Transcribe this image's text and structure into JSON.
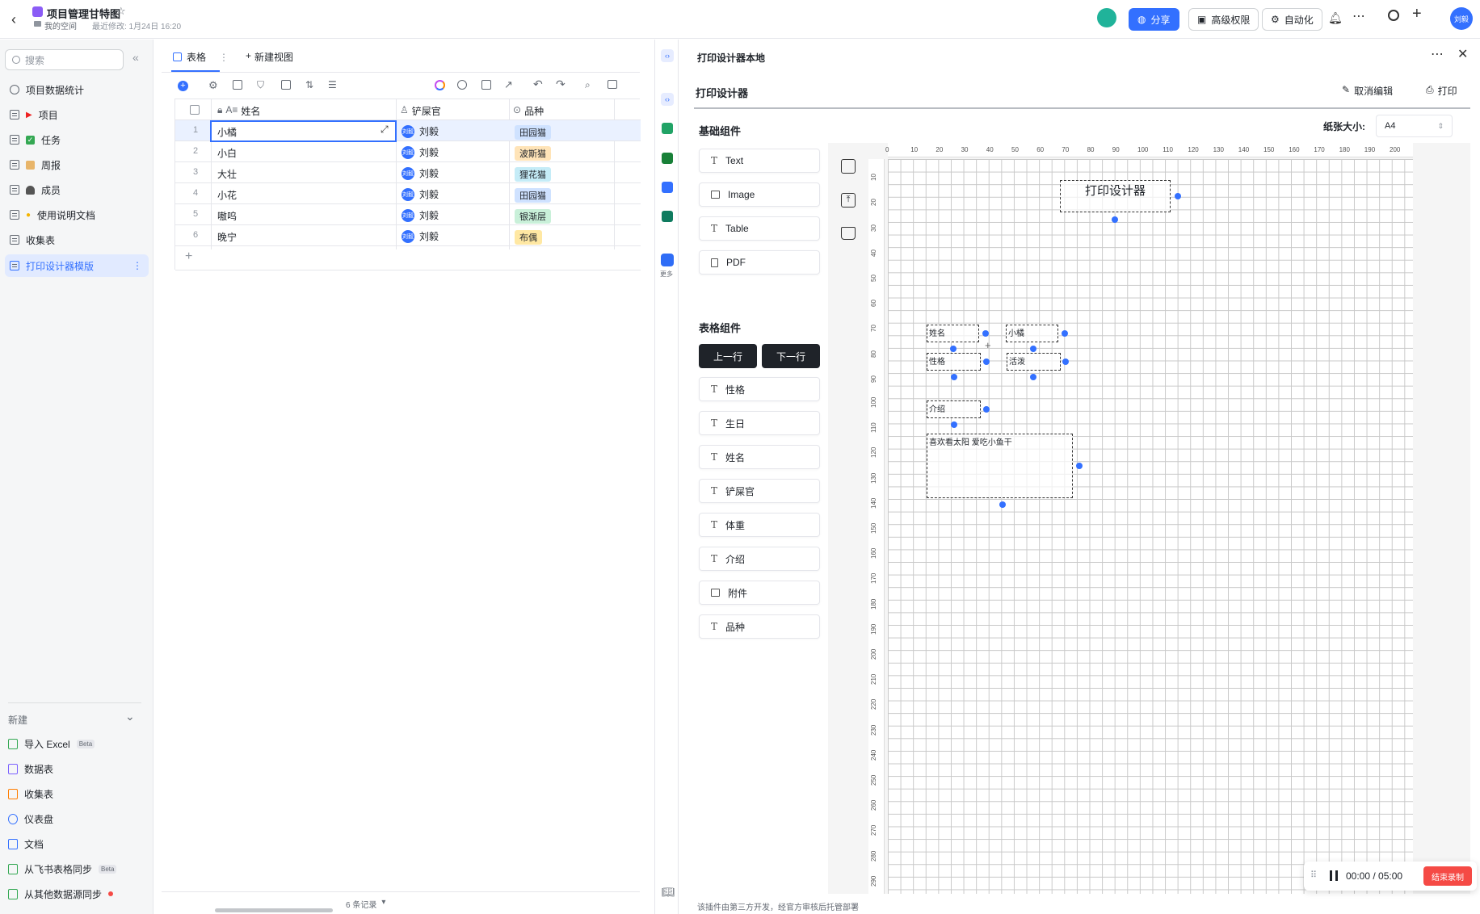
{
  "header": {
    "doc_title": "项目管理甘特图",
    "space_label": "我的空间",
    "last_modified": "最近修改: 1月24日 16:20",
    "share_label": "分享",
    "permission_label": "高级权限",
    "automation_label": "自动化",
    "user_initials": "刘毅"
  },
  "sidebar": {
    "search_placeholder": "搜索",
    "items": [
      {
        "label": "项目数据统计"
      },
      {
        "label": "项目"
      },
      {
        "label": "任务"
      },
      {
        "label": "周报"
      },
      {
        "label": "成员"
      },
      {
        "label": "使用说明文档"
      },
      {
        "label": "收集表"
      },
      {
        "label": "打印设计器模版"
      }
    ],
    "new_section": "新建",
    "new_items": [
      {
        "label": "导入 Excel",
        "badge": "Beta",
        "color": "#34a853"
      },
      {
        "label": "数据表",
        "color": "#7b61ff"
      },
      {
        "label": "收集表",
        "color": "#ff7d00"
      },
      {
        "label": "仪表盘",
        "color": "#3370ff"
      },
      {
        "label": "文档",
        "color": "#3370ff"
      },
      {
        "label": "从飞书表格同步",
        "badge": "Beta",
        "color": "#34a853"
      },
      {
        "label": "从其他数据源同步",
        "color": "#34a853"
      }
    ]
  },
  "table": {
    "view_tab": "表格",
    "new_view": "新建视图",
    "columns": [
      "姓名",
      "铲屎官",
      "品种"
    ],
    "rows": [
      {
        "n": "1",
        "name": "小橘",
        "owner": "刘毅",
        "breed": "田园猫",
        "color": "#cfe2ff"
      },
      {
        "n": "2",
        "name": "小白",
        "owner": "刘毅",
        "breed": "波斯猫",
        "color": "#ffe4b8"
      },
      {
        "n": "3",
        "name": "大壮",
        "owner": "刘毅",
        "breed": "狸花猫",
        "color": "#c5ecf7"
      },
      {
        "n": "4",
        "name": "小花",
        "owner": "刘毅",
        "breed": "田园猫",
        "color": "#cfe2ff"
      },
      {
        "n": "5",
        "name": "嗷呜",
        "owner": "刘毅",
        "breed": "银渐层",
        "color": "#c9f0d9"
      },
      {
        "n": "6",
        "name": "晚宁",
        "owner": "刘毅",
        "breed": "布偶",
        "color": "#ffe8a3"
      }
    ],
    "records": "6 条记录"
  },
  "plugin_more": "更多",
  "panel": {
    "title": "打印设计器本地",
    "subtitle": "打印设计器",
    "cancel_edit": "取消编辑",
    "print": "打印",
    "basic_title": "基础组件",
    "basic": [
      "Text",
      "Image",
      "Table",
      "PDF"
    ],
    "table_title": "表格组件",
    "prev_row": "上一行",
    "next_row": "下一行",
    "fields": [
      {
        "label": "性格",
        "icon": "T"
      },
      {
        "label": "生日",
        "icon": "T"
      },
      {
        "label": "姓名",
        "icon": "T"
      },
      {
        "label": "铲屎官",
        "icon": "T"
      },
      {
        "label": "体重",
        "icon": "T"
      },
      {
        "label": "介绍",
        "icon": "T"
      },
      {
        "label": "附件",
        "icon": "img"
      },
      {
        "label": "品种",
        "icon": "T"
      }
    ],
    "paper_label": "纸张大小:",
    "paper_value": "A4",
    "footer_note": "该插件由第三方开发，经官方审核后托管部署"
  },
  "canvas": {
    "title": "打印设计器",
    "name_label": "姓名",
    "name_value": "小橘",
    "trait_label": "性格",
    "trait_value": "活泼",
    "intro_label": "介绍",
    "intro_value": "喜欢看太阳 爱吃小鱼干"
  },
  "ruler": {
    "top": [
      "0",
      "10",
      "20",
      "30",
      "40",
      "50",
      "60",
      "70",
      "80",
      "90",
      "100",
      "110",
      "120",
      "130",
      "140",
      "150",
      "160",
      "170",
      "180",
      "190",
      "200"
    ],
    "left": [
      "10",
      "20",
      "30",
      "40",
      "50",
      "60",
      "70",
      "80",
      "90",
      "100",
      "110",
      "120",
      "130",
      "140",
      "150",
      "160",
      "170",
      "180",
      "190",
      "200",
      "210",
      "220",
      "230",
      "240",
      "250",
      "260",
      "270",
      "280",
      "290"
    ]
  },
  "recorder": {
    "time": "00:00 / 05:00",
    "stop": "结束录制"
  }
}
